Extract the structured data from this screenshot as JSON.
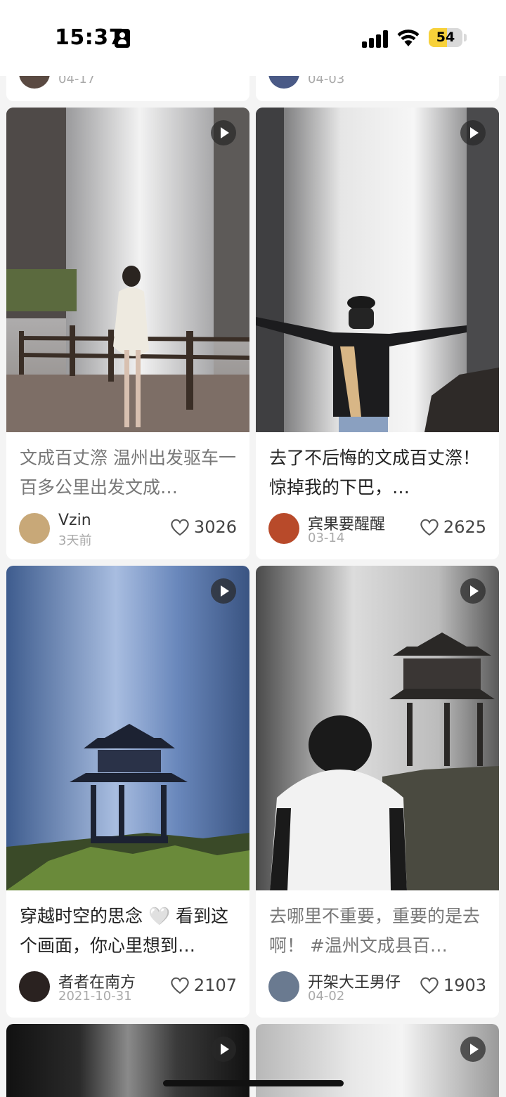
{
  "status_bar": {
    "time": "15:37",
    "battery": "54",
    "battery_level_percent": 54
  },
  "top_stubs": [
    {
      "date": "04-17"
    },
    {
      "date": "04-03"
    }
  ],
  "cards": [
    {
      "title": "文成百丈漈 温州出发驱车一百多公里出发文成…",
      "author": "Vzin",
      "date": "3天前",
      "likes": "3026",
      "image_icon": "play-icon"
    },
    {
      "title": "去了不后悔的文成百丈漈！ 惊掉我的下巴，…",
      "author": "宾果要醒醒",
      "date": "03-14",
      "likes": "2625",
      "image_icon": "play-icon"
    },
    {
      "title": "穿越时空的思念 🤍 看到这个画面，你心里想到…",
      "author": "者者在南方",
      "date": "2021-10-31",
      "likes": "2107",
      "image_icon": "play-icon"
    },
    {
      "title": "去哪里不重要，重要的是去啊！ #温州文成县百…",
      "author": "开架大王男仔",
      "date": "04-02",
      "likes": "1903",
      "image_icon": "play-icon"
    }
  ],
  "colors": {
    "background": "#f4f4f4",
    "card": "#ffffff",
    "battery_fill": "#f7d13a"
  }
}
